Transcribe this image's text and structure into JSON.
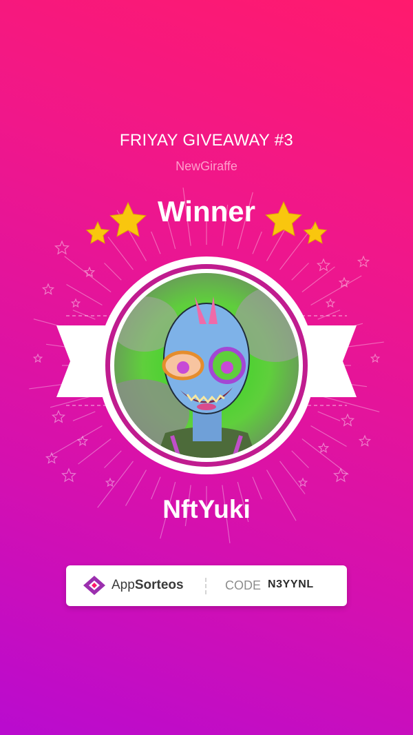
{
  "header": {
    "giveaway_title": "FRIYAY GIVEAWAY #3",
    "organizer": "NewGiraffe"
  },
  "award": {
    "label": "Winner",
    "winner_name": "NftYuki",
    "avatar_icon": "nft-zombie-avatar"
  },
  "code_card": {
    "brand_prefix": "App",
    "brand_suffix": "Sorteos",
    "logo_icon": "appsorteos-logo",
    "code_label": "CODE",
    "code_value": "N3YYNL"
  },
  "colors": {
    "background_top": "#ff1a6d",
    "background_bottom": "#b90bcf",
    "star": "#f9c60e",
    "ring": "#c01c8f",
    "brand_purple": "#9b2fae"
  }
}
